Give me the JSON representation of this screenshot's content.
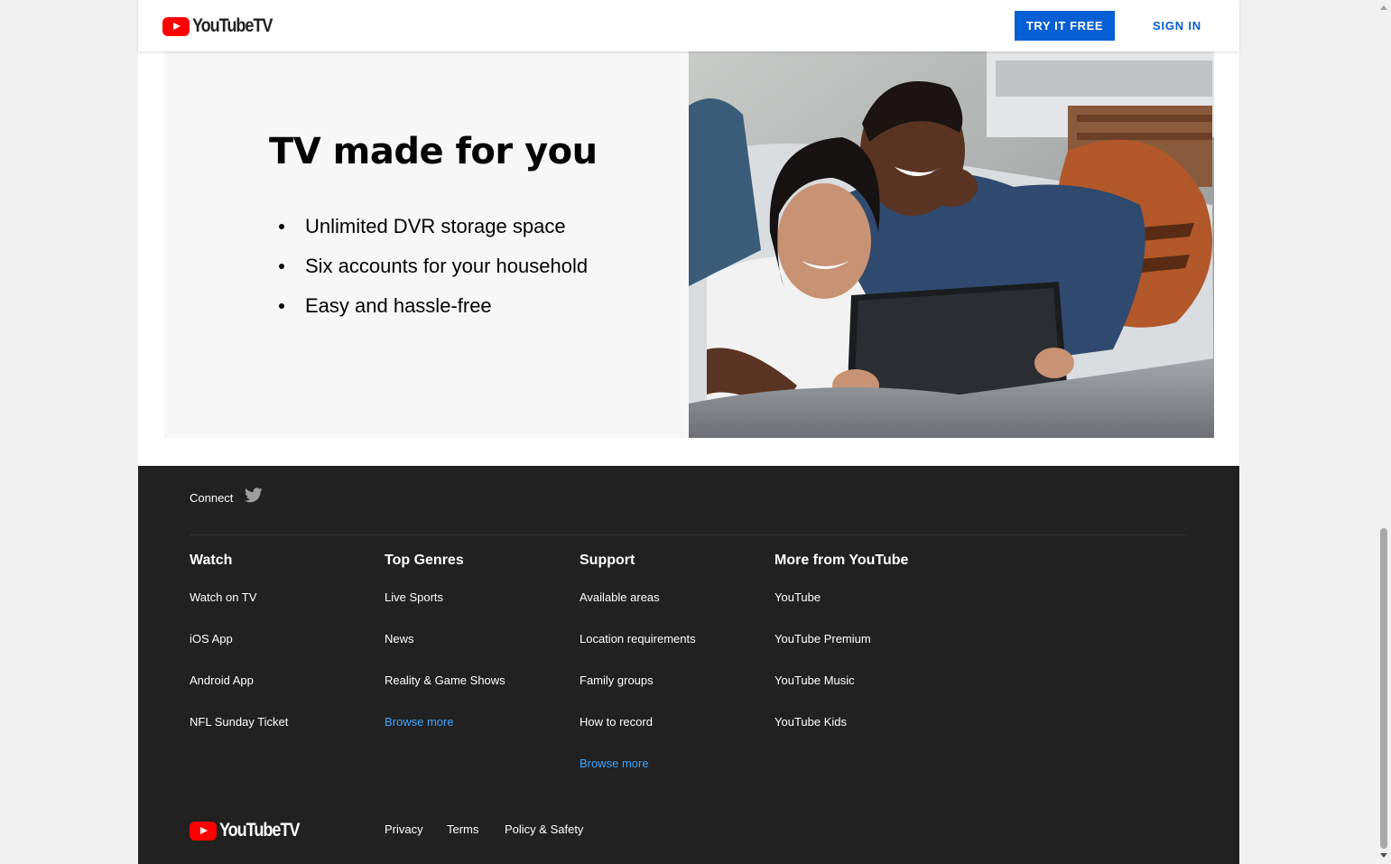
{
  "header": {
    "logo_text": "YouTubeTV",
    "try_free_label": "TRY IT FREE",
    "sign_in_label": "SIGN IN"
  },
  "hero": {
    "title": "TV made for you",
    "bullets": [
      "Unlimited DVR storage space",
      "Six accounts for your household",
      "Easy and hassle-free"
    ]
  },
  "footer": {
    "connect_label": "Connect",
    "social_icon": "twitter-icon",
    "columns": [
      {
        "heading": "Watch",
        "links": [
          "Watch on TV",
          "iOS App",
          "Android App",
          "NFL Sunday Ticket"
        ]
      },
      {
        "heading": "Top Genres",
        "links": [
          "Live Sports",
          "News",
          "Reality & Game Shows",
          "Browse more"
        ]
      },
      {
        "heading": "Support",
        "links": [
          "Available areas",
          "Location requirements",
          "Family groups",
          "How to record",
          "Browse more"
        ]
      },
      {
        "heading": "More from YouTube",
        "links": [
          "YouTube",
          "YouTube Premium",
          "YouTube Music",
          "YouTube Kids"
        ]
      }
    ],
    "logo_text": "YouTubeTV",
    "legal_links": [
      "Privacy",
      "Terms",
      "Policy & Safety"
    ]
  },
  "colors": {
    "brand_red": "#ff0000",
    "accent_blue": "#065fd4",
    "link_blue": "#3ea6ff",
    "footer_bg": "#212121"
  }
}
